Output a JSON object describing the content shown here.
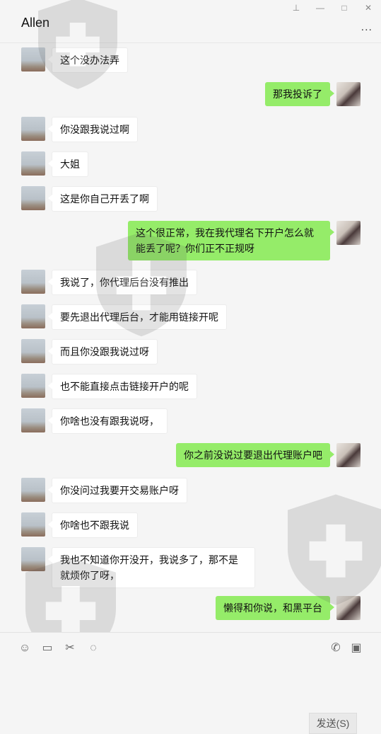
{
  "window": {
    "contact_name": "Allen",
    "controls": [
      "pin-icon",
      "minimize-icon",
      "maximize-icon",
      "close-icon"
    ],
    "more_label": "..."
  },
  "messages": [
    {
      "side": "left",
      "text": "这个没办法弄"
    },
    {
      "side": "right",
      "text": "那我投诉了"
    },
    {
      "side": "left",
      "text": "你没跟我说过啊"
    },
    {
      "side": "left",
      "text": "大姐"
    },
    {
      "side": "left",
      "text": "这是你自己开丢了啊"
    },
    {
      "side": "right",
      "text": "这个很正常，我在我代理名下开户怎么就能丢了呢？你们正不正规呀"
    },
    {
      "side": "left",
      "text": "我说了，你代理后台没有推出"
    },
    {
      "side": "left",
      "text": "要先退出代理后台，才能用链接开呢"
    },
    {
      "side": "left",
      "text": "而且你没跟我说过呀"
    },
    {
      "side": "left",
      "text": "也不能直接点击链接开户的呢"
    },
    {
      "side": "left",
      "text": "你啥也没有跟我说呀，"
    },
    {
      "side": "right",
      "text": "你之前没说过要退出代理账户吧"
    },
    {
      "side": "left",
      "text": "你没问过我要开交易账户呀"
    },
    {
      "side": "left",
      "text": "你啥也不跟我说"
    },
    {
      "side": "left",
      "text": "我也不知道你开没开，我说多了，那不是就烦你了呀，"
    },
    {
      "side": "right",
      "text": "懒得和你说，和黑平台"
    }
  ],
  "toolbar": {
    "icons": [
      "emoji-icon",
      "folder-icon",
      "scissors-icon",
      "chat-icon",
      "phone-icon",
      "video-icon"
    ]
  },
  "send_label": "发送(S)",
  "colors": {
    "my_bubble": "#95ec69",
    "their_bubble": "#ffffff",
    "background": "#f5f5f5"
  }
}
